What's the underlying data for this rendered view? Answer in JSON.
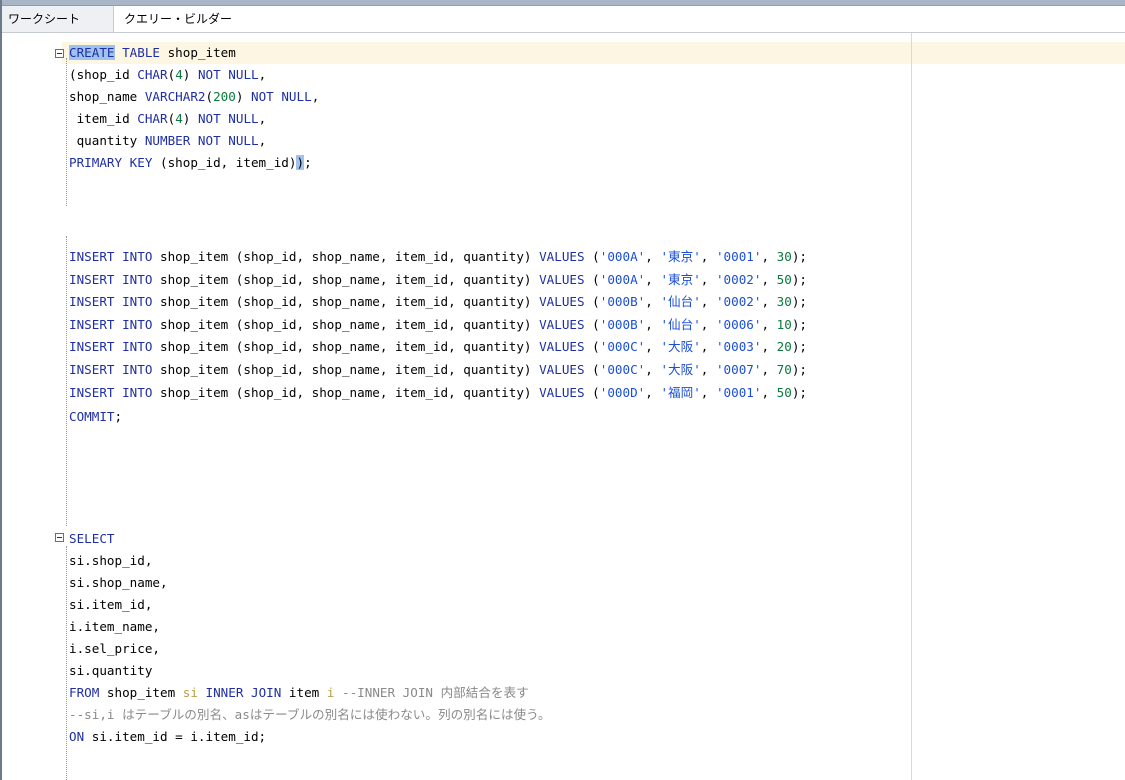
{
  "tabs": {
    "worksheet": "ワークシート",
    "query_builder": "クエリー・ビルダー"
  },
  "sql": {
    "create": {
      "kw_create": "CREATE",
      "kw_table": " TABLE",
      "table_name": " shop_item",
      "col1": "(shop_id ",
      "col1_type": "CHAR",
      "col1_p1": "(",
      "col1_len": "4",
      "col1_p2": ") ",
      "col1_nn": "NOT NULL",
      "col1_end": ",",
      "col2": "shop_name ",
      "col2_type": "VARCHAR2",
      "col2_p1": "(",
      "col2_len": "200",
      "col2_p2": ") ",
      "col2_nn": "NOT NULL",
      "col2_end": ",",
      "col3": " item_id ",
      "col3_type": "CHAR",
      "col3_p1": "(",
      "col3_len": "4",
      "col3_p2": ") ",
      "col3_nn": "NOT NULL",
      "col3_end": ",",
      "col4": " quantity ",
      "col4_type": "NUMBER",
      "col4_sp": " ",
      "col4_nn": "NOT NULL",
      "col4_end": ",",
      "pk_kw": "PRIMARY KEY",
      "pk_cols": " (shop_id, item_id)",
      "pk_close": ")",
      "pk_end": ";"
    },
    "insert": {
      "kw_insert": "INSERT INTO",
      "mid": " shop_item (shop_id, shop_name, item_id, quantity) ",
      "kw_values": "VALUES",
      "rows": [
        {
          "shop_id": "'000A'",
          "shop_name": "'東京'",
          "item_id": "'0001'",
          "quantity": "30"
        },
        {
          "shop_id": "'000A'",
          "shop_name": "'東京'",
          "item_id": "'0002'",
          "quantity": "50"
        },
        {
          "shop_id": "'000B'",
          "shop_name": "'仙台'",
          "item_id": "'0002'",
          "quantity": "30"
        },
        {
          "shop_id": "'000B'",
          "shop_name": "'仙台'",
          "item_id": "'0006'",
          "quantity": "10"
        },
        {
          "shop_id": "'000C'",
          "shop_name": "'大阪'",
          "item_id": "'0003'",
          "quantity": "20"
        },
        {
          "shop_id": "'000C'",
          "shop_name": "'大阪'",
          "item_id": "'0007'",
          "quantity": "70"
        },
        {
          "shop_id": "'000D'",
          "shop_name": "'福岡'",
          "item_id": "'0001'",
          "quantity": "50"
        }
      ]
    },
    "commit": "COMMIT",
    "commit_end": ";",
    "select": {
      "kw_select": "SELECT",
      "cols": [
        "si.shop_id,",
        "si.shop_name,",
        "si.item_id,",
        "i.item_name,",
        "i.sel_price,",
        "si.quantity"
      ],
      "kw_from": "FROM",
      "from_table": " shop_item ",
      "alias_si": "si",
      "kw_inner_join": " INNER JOIN",
      "join_table": " item ",
      "alias_i": "i",
      "comment1": " --INNER JOIN 内部結合を表す",
      "comment2": "--si,i はテーブルの別名、asはテーブルの別名には使わない。列の別名には使う。",
      "kw_on": "ON",
      "on_cond": " si.item_id = i.item_id;"
    }
  },
  "colors": {
    "keyword": "#1f2fa3",
    "number": "#0a7a3d",
    "string": "#1b4fd6",
    "alias": "#b8a14c",
    "comment": "#8a8a8a",
    "selection": "#9fc3ec"
  }
}
